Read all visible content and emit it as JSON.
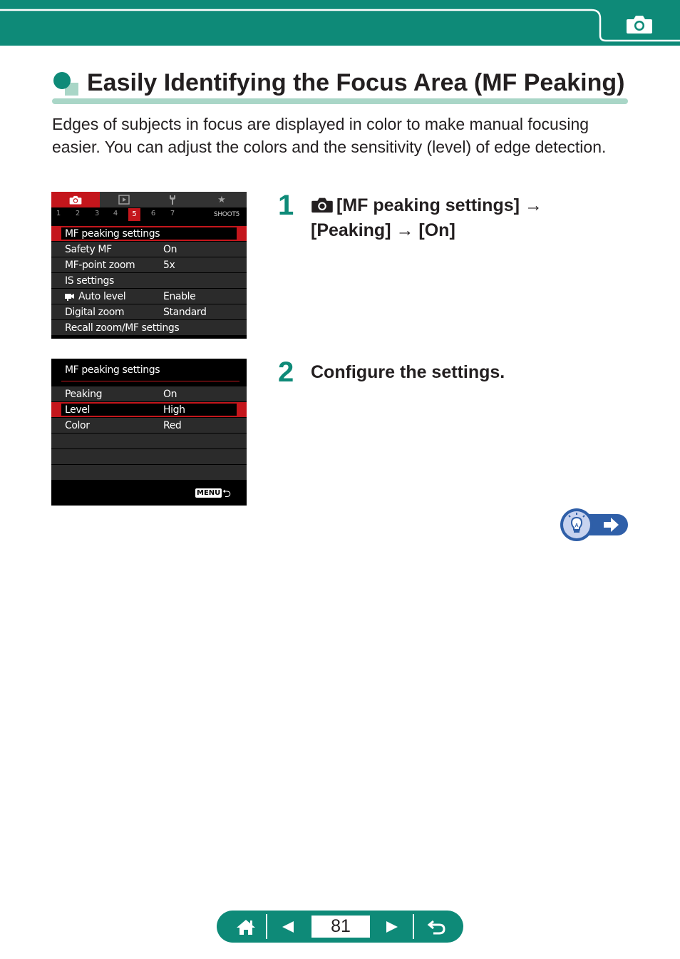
{
  "header": {
    "icon": "camera-icon",
    "accent_color": "#0e8a78"
  },
  "section": {
    "title": "Easily Identifying the Focus Area (MF Peaking)",
    "intro": "Edges of subjects in focus are displayed in color to make manual focusing easier. You can adjust the colors and the sensitivity (level) of edge detection."
  },
  "screen1": {
    "tabs": [
      "camera-icon",
      "playback-icon",
      "wrench-icon",
      "star-icon"
    ],
    "page_numbers": [
      "1",
      "2",
      "3",
      "4",
      "5",
      "6",
      "7"
    ],
    "active_page": "5",
    "tab_label": "SHOOT5",
    "items": [
      {
        "label": "MF peaking settings",
        "value": ""
      },
      {
        "label": "Safety MF",
        "value": "On"
      },
      {
        "label": "MF-point zoom",
        "value": "5x"
      },
      {
        "label": "IS settings",
        "value": ""
      },
      {
        "label": "Auto level",
        "value": "Enable"
      },
      {
        "label": "Digital zoom",
        "value": "Standard"
      },
      {
        "label": "Recall zoom/MF settings",
        "value": ""
      }
    ]
  },
  "screen2": {
    "title": "MF peaking settings",
    "items": [
      {
        "label": "Peaking",
        "value": "On"
      },
      {
        "label": "Level",
        "value": "High"
      },
      {
        "label": "Color",
        "value": "Red"
      }
    ],
    "menu_label": "MENU"
  },
  "steps": [
    {
      "number": "1",
      "text_part1": "[MF peaking settings] →",
      "text_part2": "[Peaking] → [On]"
    },
    {
      "number": "2",
      "text": "Configure the settings."
    }
  ],
  "nav": {
    "page_number": "81"
  }
}
